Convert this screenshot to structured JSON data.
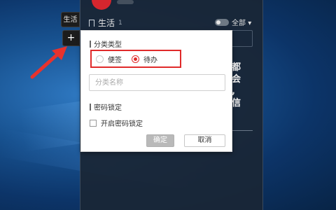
{
  "side_tabs": {
    "active_label": "生活",
    "add_label": "+"
  },
  "panel": {
    "title": "生活",
    "count": "1",
    "filter_label": "全部",
    "note_preview_lines": [
      "都",
      "会",
      ",",
      "信"
    ]
  },
  "dialog": {
    "category_type_label": "分类类型",
    "options": [
      {
        "label": "便签",
        "selected": false
      },
      {
        "label": "待办",
        "selected": true
      }
    ],
    "name_placeholder": "分类名称",
    "lock_section_label": "密码锁定",
    "lock_checkbox_label": "开启密码锁定",
    "ok_label": "确定",
    "cancel_label": "取消"
  },
  "colors": {
    "highlight": "#e02a2a",
    "accent": "#d6262e"
  }
}
